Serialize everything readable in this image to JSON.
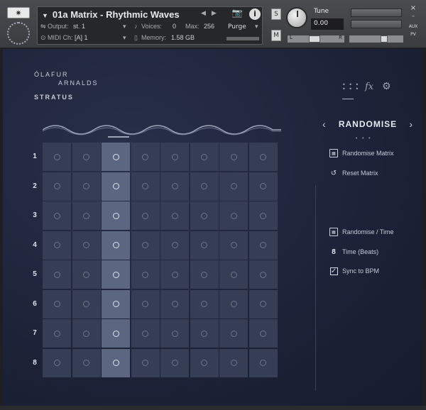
{
  "header": {
    "instrument_name": "01a Matrix - Rhythmic Waves",
    "output_label": "Output:",
    "output_value": "st. 1",
    "voices_label": "Voices:",
    "voices_value": "0",
    "max_label": "Max:",
    "max_value": "256",
    "midi_label": "MIDI Ch:",
    "midi_value": "[A]  1",
    "memory_label": "Memory:",
    "memory_value": "1.58 GB",
    "purge_label": "Purge",
    "solo_label": "S",
    "mute_label": "M",
    "tune_label": "Tune",
    "tune_value": "0.00",
    "pan_left": "L",
    "pan_right": "R",
    "side_close": "×",
    "side_minimize": "–",
    "side_aux": "AUX",
    "side_pv": "PV"
  },
  "branding": {
    "line1": "ÓLAFUR",
    "line2": "ARNALDS",
    "product": "STRATUS"
  },
  "tabs": [
    {
      "name": "matrix",
      "icon": "dots-grid-icon"
    },
    {
      "name": "fx",
      "icon": "fx-icon",
      "label": "fx"
    },
    {
      "name": "settings",
      "icon": "gear-icon"
    }
  ],
  "matrix": {
    "rows": [
      "1",
      "2",
      "3",
      "4",
      "5",
      "6",
      "7",
      "8"
    ],
    "columns": 8,
    "highlighted_column": 3
  },
  "panel": {
    "title": "RANDOMISE",
    "randomise_matrix": "Randomise Matrix",
    "reset_matrix": "Reset Matrix",
    "randomise_time": "Randomise / Time",
    "time_value": "8",
    "time_label": "Time (Beats)",
    "sync_label": "Sync to BPM",
    "sync_checked": true
  },
  "colors": {
    "background": "#1c2237",
    "cell": "#363e56",
    "cell_highlight": "#5b6680",
    "text": "#c7ccd9"
  }
}
